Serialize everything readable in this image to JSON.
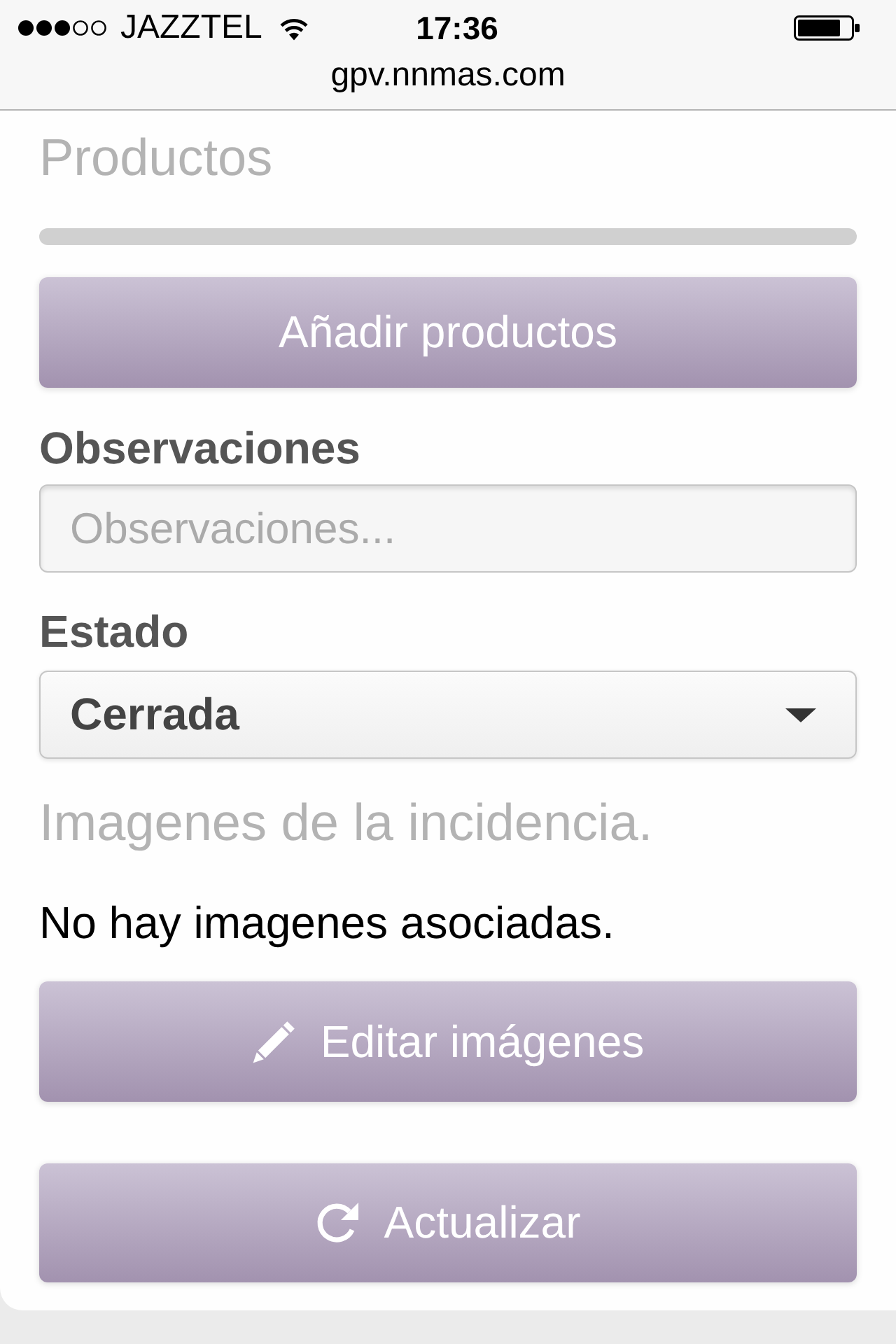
{
  "status_bar": {
    "carrier": "JAZZTEL",
    "time": "17:36"
  },
  "address_bar": {
    "url": "gpv.nnmas.com"
  },
  "products": {
    "title": "Productos",
    "add_button": "Añadir productos"
  },
  "observations": {
    "label": "Observaciones",
    "placeholder": "Observaciones..."
  },
  "state": {
    "label": "Estado",
    "value": "Cerrada"
  },
  "images": {
    "title": "Imagenes de la incidencia.",
    "empty_message": "No hay imagenes asociadas.",
    "edit_button": "Editar imágenes"
  },
  "refresh_button": "Actualizar"
}
